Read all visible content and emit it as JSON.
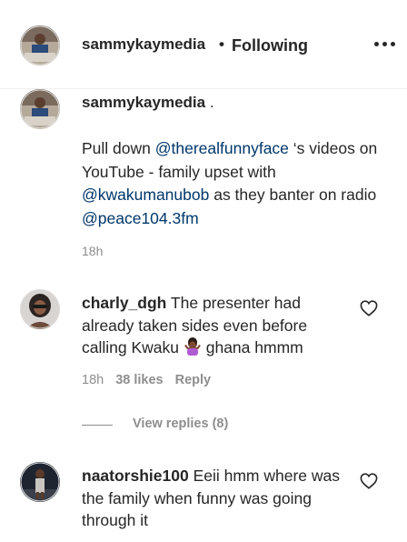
{
  "header": {
    "username": "sammykaymedia",
    "separator": "•",
    "follow_status": "Following",
    "more_icon": "more-horizontal-icon"
  },
  "caption": {
    "username": "sammykaymedia",
    "username_suffix": " .",
    "text_before_1": "Pull down ",
    "mention_1": "@therealfunnyface",
    "text_after_1": " ‘s videos on YouTube - family upset with ",
    "mention_2": "@kwakumanubob",
    "text_after_2": " as they banter on radio ",
    "mention_3": "@peace104.3fm",
    "time": "18h"
  },
  "comments": [
    {
      "username": "charly_dgh",
      "text_before_emoji": " The presenter had already taken sides even before calling Kwaku ",
      "emoji": "person-shrugging-emoji",
      "text_after_emoji": " ghana hmmm",
      "time": "18h",
      "likes": "38 likes",
      "reply_label": "Reply",
      "view_replies": "View replies (8)"
    },
    {
      "username": "naatorshie100",
      "text": " Eeii hmm where was the family when funny was going through it"
    }
  ],
  "colors": {
    "text": "#262626",
    "secondary": "#8e8e8e",
    "mention": "#00376b",
    "divider": "#efefef"
  }
}
